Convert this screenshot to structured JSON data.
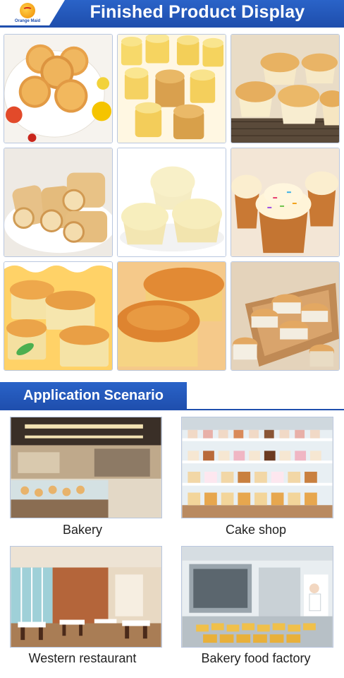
{
  "header": {
    "title": "Finished Product Display",
    "logo_text": "Orange Maid",
    "brand_color": "#1f4fae"
  },
  "products": [
    {
      "name": "sponge-cakes-on-plate"
    },
    {
      "name": "mini-cylinder-cakes"
    },
    {
      "name": "paper-cup-cakes-on-rack"
    },
    {
      "name": "swiss-rolls"
    },
    {
      "name": "steamed-cup-cakes"
    },
    {
      "name": "frosted-cupcakes-with-sprinkles"
    },
    {
      "name": "paper-wrapped-cakes"
    },
    {
      "name": "chiffon-cakes-closeup"
    },
    {
      "name": "muffins-in-box"
    }
  ],
  "application": {
    "heading": "Application Scenario",
    "scenes": [
      {
        "label": "Bakery"
      },
      {
        "label": "Cake shop"
      },
      {
        "label": "Western restaurant"
      },
      {
        "label": "Bakery food factory"
      }
    ]
  }
}
